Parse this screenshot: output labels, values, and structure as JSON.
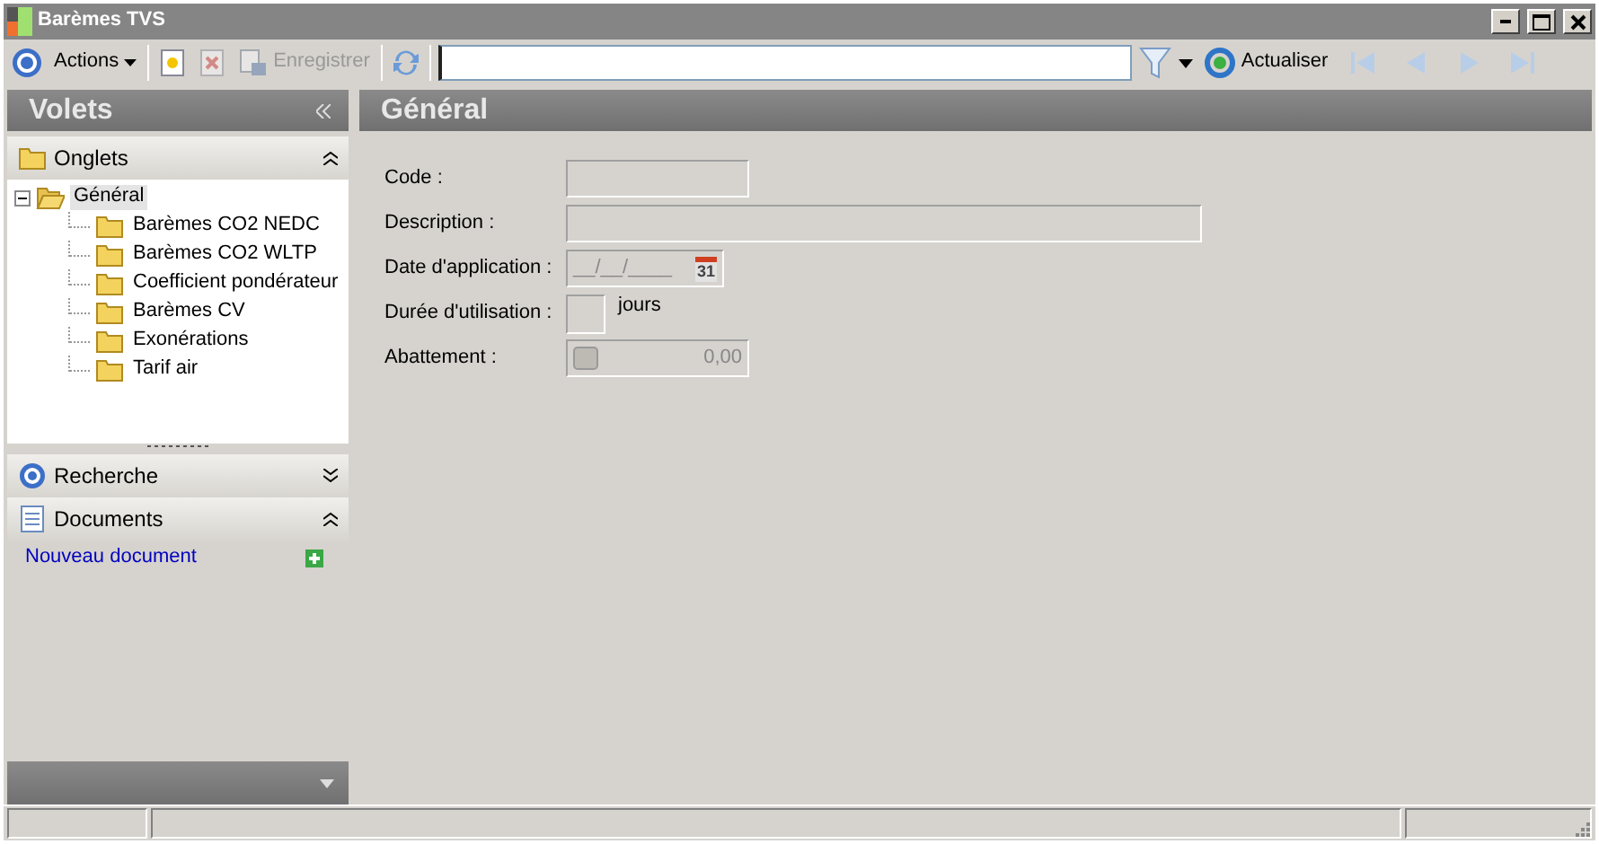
{
  "window": {
    "title": "Barèmes TVS"
  },
  "toolbar": {
    "actions_label": "Actions",
    "save_label": "Enregistrer",
    "save_disabled": true,
    "new_disabled": false,
    "delete_disabled": true,
    "refresh_label": "Actualiser",
    "nav_disabled": true
  },
  "sidebar": {
    "title": "Volets",
    "sections": [
      {
        "kind": "tree",
        "label": "Onglets",
        "expanded": true,
        "tree": [
          {
            "label": "Général",
            "expanded": true,
            "selected": true,
            "children": [
              {
                "label": "Barèmes CO2 NEDC",
                "selected": false
              },
              {
                "label": "Barèmes CO2 WLTP",
                "selected": false
              },
              {
                "label": "Coefficient pondérateur",
                "selected": false
              },
              {
                "label": "Barèmes CV",
                "selected": false
              },
              {
                "label": "Exonérations",
                "selected": false
              },
              {
                "label": "Tarif air",
                "selected": false
              }
            ]
          }
        ]
      },
      {
        "kind": "search",
        "label": "Recherche",
        "expanded": false
      },
      {
        "kind": "documents",
        "label": "Documents",
        "expanded": true,
        "links": [
          "Nouveau document"
        ]
      }
    ]
  },
  "content": {
    "title": "Général",
    "fields": [
      {
        "kind": "short_text",
        "label": "Code :"
      },
      {
        "kind": "long_text",
        "label": "Description :"
      },
      {
        "kind": "date",
        "label": "Date d'application :",
        "value": "__/__/____",
        "icon_text": "31"
      },
      {
        "kind": "days",
        "label": "Durée d'utilisation :",
        "unit": "jours"
      },
      {
        "kind": "number",
        "label": "Abattement :",
        "value": "0,00"
      }
    ]
  }
}
